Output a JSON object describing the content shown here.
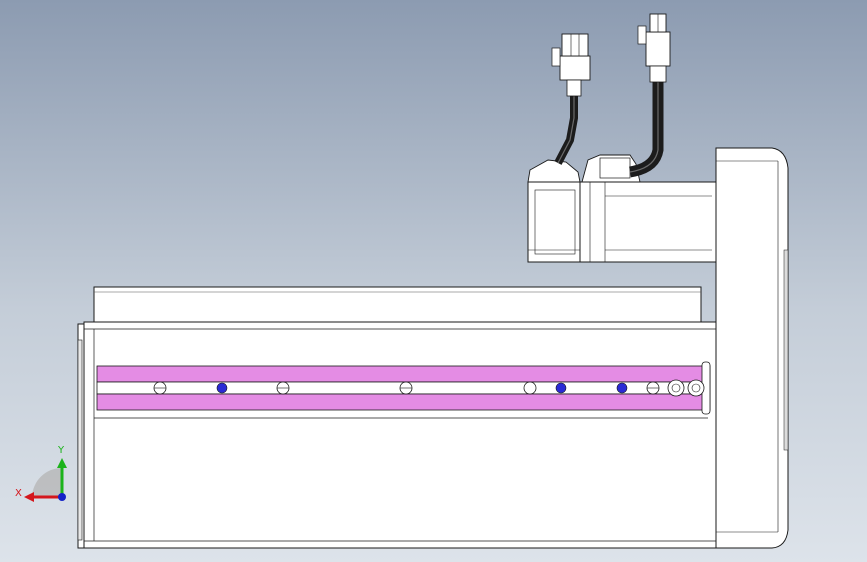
{
  "viewport": {
    "background_top": "#8c9bb1",
    "background_bottom": "#dde3ea"
  },
  "triad": {
    "x_label": "X",
    "y_label": "Y",
    "x_color": "#d4161c",
    "y_color": "#1bb31b",
    "z_color": "#1422c8"
  },
  "colors": {
    "body_fill": "#ffffff",
    "outline": "#1a1a1a",
    "slot_fill": "#e48ce4",
    "hole_blue": "#2a2ad6",
    "cable": "#1c1c1c",
    "motor_fill": "#ffffff"
  },
  "model": {
    "parts": [
      "carriage-plate",
      "rail-body",
      "t-slot-strip",
      "end-cap-left",
      "drive-housing",
      "servo-motor",
      "motor-brake",
      "power-cable",
      "encoder-cable",
      "connector-left",
      "connector-right"
    ],
    "slot_holes": [
      {
        "type": "open"
      },
      {
        "type": "blue"
      },
      {
        "type": "open"
      },
      {
        "type": "open"
      },
      {
        "type": "open"
      },
      {
        "type": "blue"
      },
      {
        "type": "blue"
      },
      {
        "type": "open"
      },
      {
        "type": "ring"
      },
      {
        "type": "ring"
      }
    ]
  }
}
